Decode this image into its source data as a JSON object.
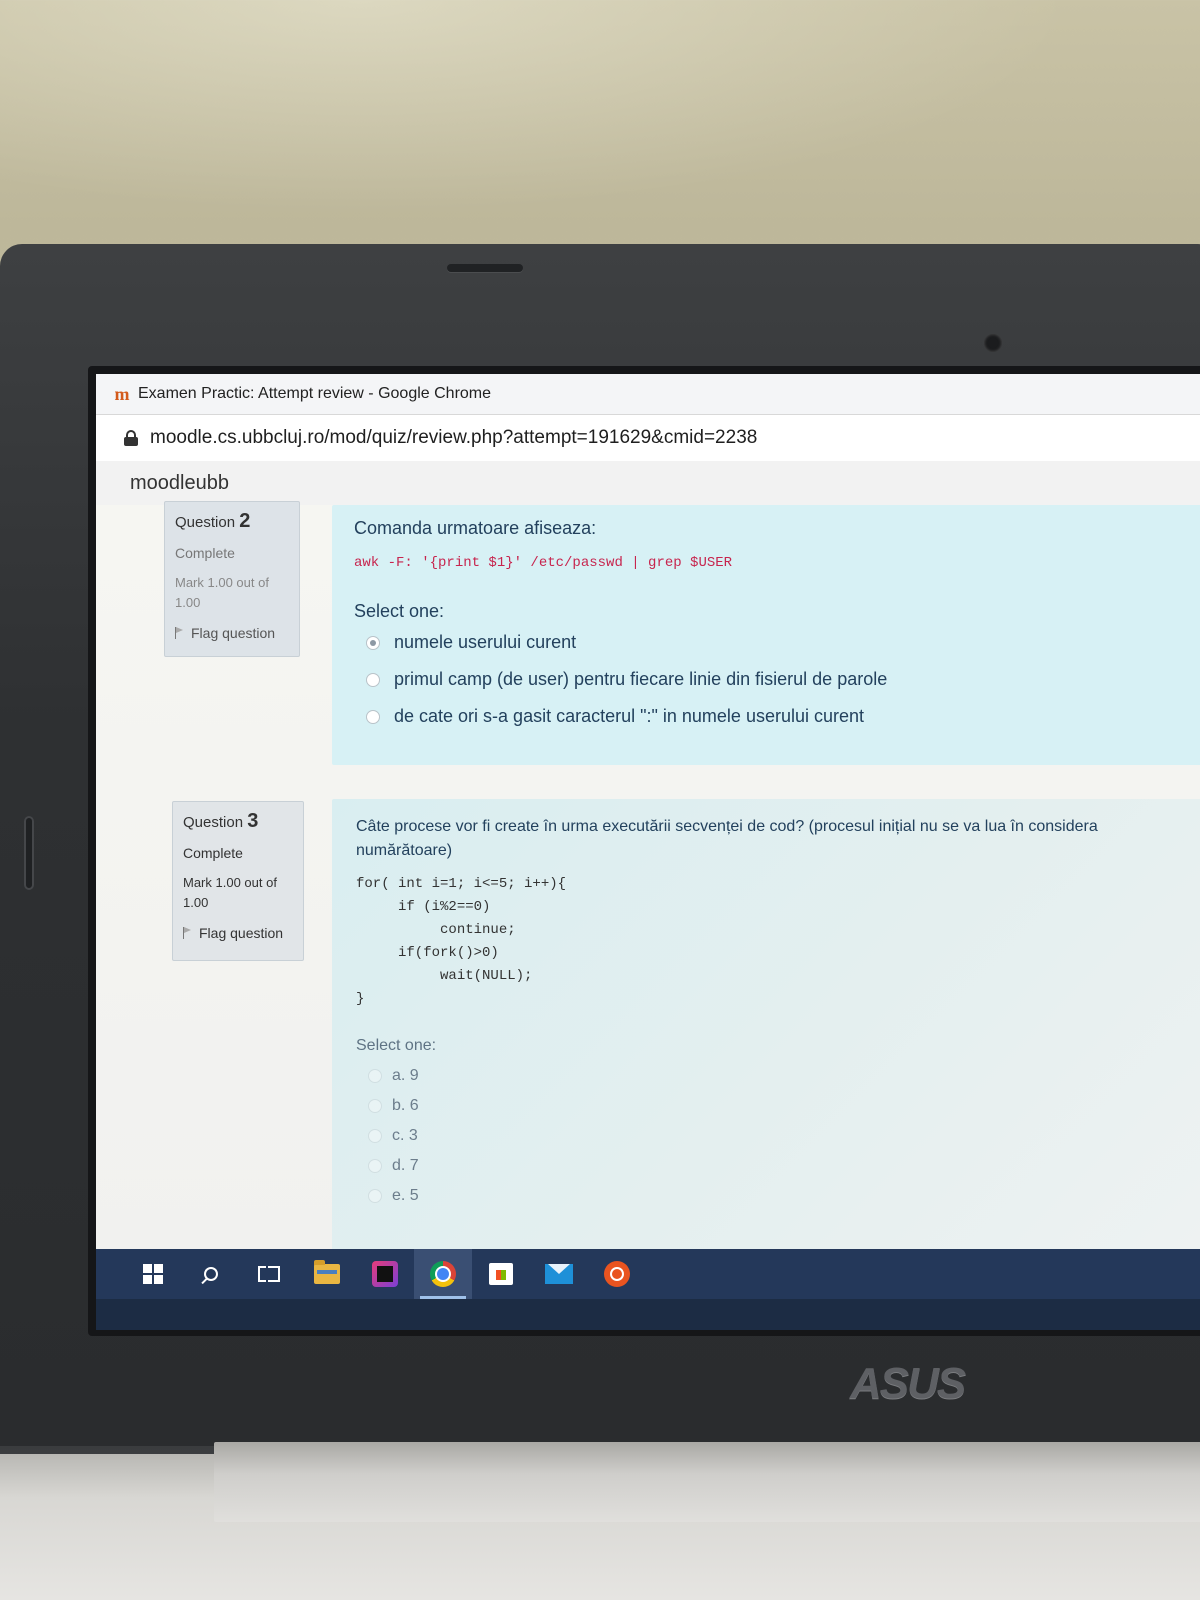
{
  "browser": {
    "window_title": "Examen Practic: Attempt review - Google Chrome",
    "favicon_icon": "moodle-logo-icon",
    "url": "moodle.cs.ubbcluj.ro/mod/quiz/review.php?attempt=191629&cmid=2238"
  },
  "site": {
    "brand": "moodleubb"
  },
  "questions": [
    {
      "label": "Question",
      "number": "2",
      "state": "Complete",
      "mark": "Mark 1.00 out of 1.00",
      "flag_label": "Flag question",
      "text": "Comanda urmatoare afiseaza:",
      "code": "awk -F: '{print $1}' /etc/passwd | grep $USER",
      "select_label": "Select one:",
      "answers": [
        {
          "label": "numele userului curent",
          "checked": true
        },
        {
          "label": "primul camp (de user) pentru fiecare linie din fisierul de parole",
          "checked": false
        },
        {
          "label": "de cate ori s-a gasit caracterul \":\" in numele userului curent",
          "checked": false
        }
      ]
    },
    {
      "label": "Question",
      "number": "3",
      "state": "Complete",
      "mark": "Mark 1.00 out of 1.00",
      "flag_label": "Flag question",
      "text": "Câte procese vor fi create în urma executării secvenței de cod? (procesul inițial nu se va lua în considera numărătoare)",
      "code_lines": [
        "for( int i=1; i<=5; i++){",
        "     if (i%2==0)",
        "          continue;",
        "     if(fork()>0)",
        "          wait(NULL);",
        "}"
      ],
      "select_label": "Select one:",
      "answers": [
        {
          "label": "a. 9"
        },
        {
          "label": "b. 6"
        },
        {
          "label": "c. 3"
        },
        {
          "label": "d. 7"
        },
        {
          "label": "e. 5"
        }
      ]
    }
  ],
  "taskbar": {
    "icons": [
      "windows-start-icon",
      "search-icon",
      "task-view-icon",
      "file-explorer-icon",
      "ide-icon",
      "chrome-icon",
      "store-icon",
      "mail-icon",
      "ubuntu-icon"
    ],
    "active": "chrome-icon"
  },
  "hardware": {
    "laptop_brand": "ASUS"
  },
  "colors": {
    "question_info_bg": "#dde3e8",
    "formulation_bg": "#d7f1f5",
    "code_inline": "#c7254e",
    "taskbar": "#24385a"
  }
}
